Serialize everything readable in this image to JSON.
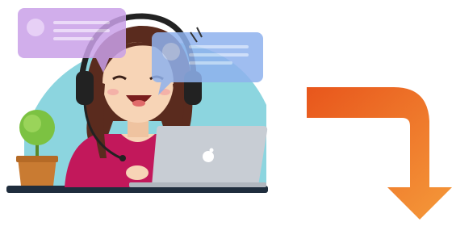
{
  "scene": {
    "description_icons": [
      "headset-icon",
      "laptop-icon",
      "apple-logo-icon",
      "chat-bubble-icon",
      "plant-icon",
      "arrow-icon"
    ]
  },
  "colors": {
    "background": "#ffffff",
    "bubble_purple": "#c9a0e8",
    "bubble_blue": "#8fb2ee",
    "backdrop_teal": "#7fd0dc",
    "hair": "#5a2b1e",
    "skin": "#f7d4b6",
    "shirt": "#c2185b",
    "laptop": "#c8cdd4",
    "desk": "#1f2d3d",
    "pot": "#c97b32",
    "plant": "#7cc242",
    "arrow_start": "#e8561c",
    "arrow_end": "#f59a3a"
  }
}
